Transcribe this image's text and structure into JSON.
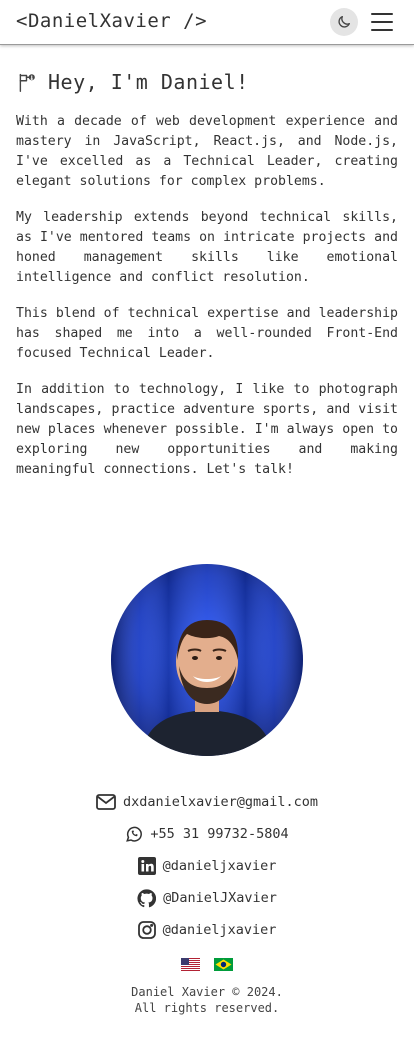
{
  "header": {
    "logo": "<DanielXavier />",
    "theme_icon": "moon-icon",
    "menu_icon": "hamburger-icon"
  },
  "about": {
    "greeting_icon": "pin-icon",
    "greeting": "Hey, I'm Daniel!",
    "paragraphs": [
      "With a decade of web development experience and mastery in JavaScript, React.js, and Node.js, I've excelled as a Technical Leader, creating elegant solutions for complex problems.",
      "My leadership extends beyond technical skills, as I've mentored teams on intricate projects and honed management skills like emotional intelligence and conflict resolution.",
      "This blend of technical expertise and leadership has shaped me into a well-rounded Front-End focused Technical Leader.",
      "In addition to technology, I like to photograph landscapes, practice adventure sports, and visit new places whenever possible. I'm always open to exploring new opportunities and making meaningful connections. Let's talk!"
    ]
  },
  "contacts": [
    {
      "icon": "email-icon",
      "text": "dxdanielxavier@gmail.com"
    },
    {
      "icon": "whatsapp-icon",
      "text": "+55 31 99732-5804"
    },
    {
      "icon": "linkedin-icon",
      "text": "@danieljxavier"
    },
    {
      "icon": "github-icon",
      "text": "@DanielJXavier"
    },
    {
      "icon": "instagram-icon",
      "text": "@danieljxavier"
    }
  ],
  "languages": [
    {
      "icon": "us-flag-icon"
    },
    {
      "icon": "brazil-flag-icon"
    }
  ],
  "footer": {
    "line1": "Daniel Xavier © 2024.",
    "line2": "All rights reserved."
  },
  "colors": {
    "text": "#333333",
    "theme_button_bg": "#e4e4e4",
    "photo_background": "#1e3fc8"
  }
}
